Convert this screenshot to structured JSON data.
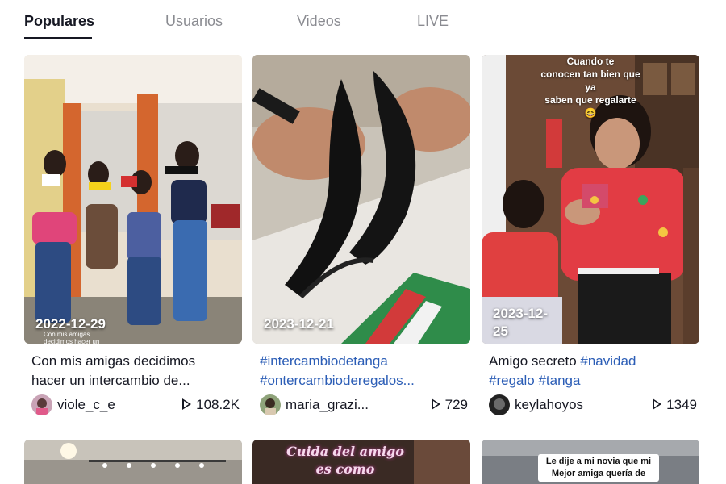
{
  "tabs": [
    {
      "label": "Populares",
      "active": true
    },
    {
      "label": "Usuarios",
      "active": false
    },
    {
      "label": "Videos",
      "active": false
    },
    {
      "label": "LIVE",
      "active": false
    }
  ],
  "videos": [
    {
      "date": "2022-12-29",
      "thumb_subtitle": "Con mis amigas decidimos hacer un",
      "caption_line1": "Con mis amigas decidimos",
      "caption_line2": "hacer un intercambio de...",
      "username": "viole_c_e",
      "plays": "108.2K"
    },
    {
      "date": "2023-12-21",
      "caption_tag1": "#intercambiodetanga",
      "caption_tag2": "#ontercambioderegalos...",
      "username": "maria_grazi...",
      "plays": "729"
    },
    {
      "date_line1": "2023-12-",
      "date_line2": "25",
      "overlay_line1": "Cuando te",
      "overlay_line2": "conocen tan bien que ya",
      "overlay_line3": "saben que regalarte 😆",
      "caption_text": "Amigo secreto ",
      "caption_tag1": "#navidad",
      "caption_tag2": "#regalo",
      "caption_tag3": "#tanga",
      "username": "keylahoyos",
      "plays": "1349"
    }
  ],
  "row2": [
    {
      "overlay_line1": "",
      "overlay_line2": ""
    },
    {
      "overlay_line1": "Cuida del amigo",
      "overlay_line2": "es como"
    },
    {
      "overlay_line1": "Le dije a mi novia que mi",
      "overlay_line2": "Mejor amiga quería de"
    }
  ],
  "colors": {
    "hashtag": "#2b5db6",
    "text": "#161823",
    "muted": "#8a8b91"
  }
}
